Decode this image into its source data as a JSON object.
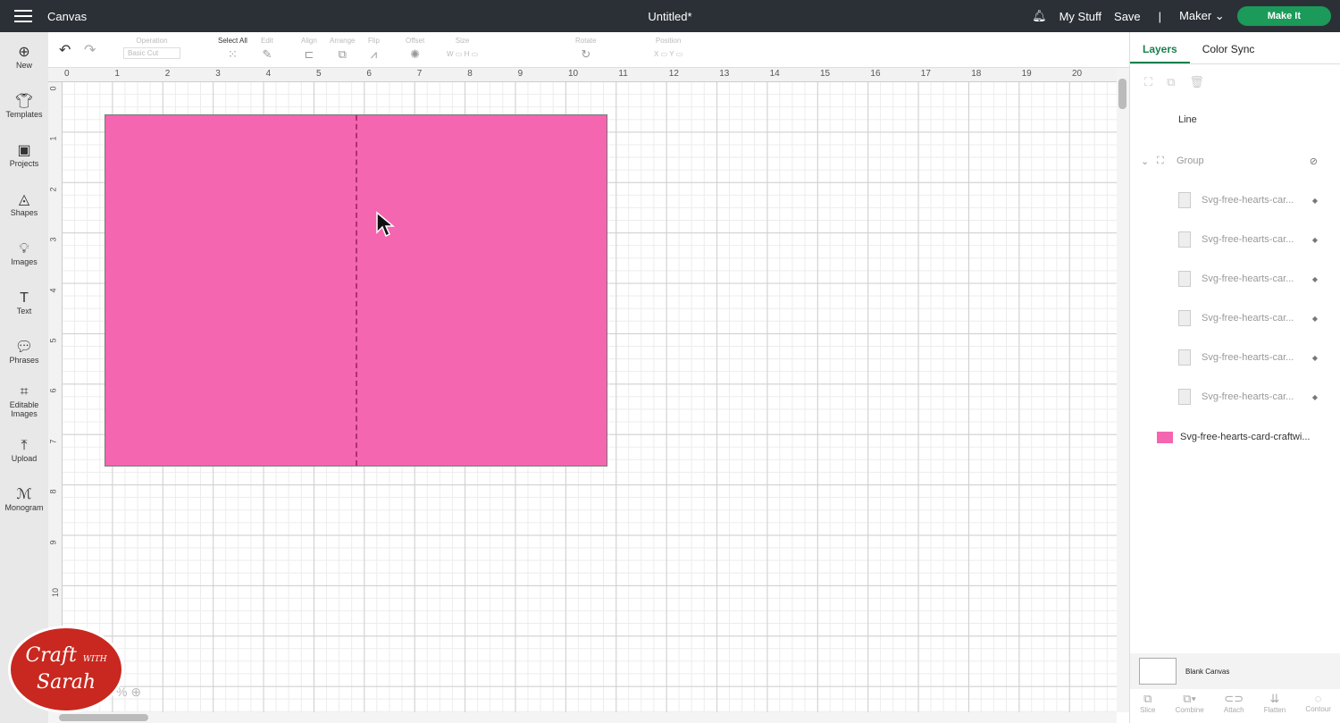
{
  "topbar": {
    "app": "Canvas",
    "doc_title": "Untitled*",
    "my_stuff": "My Stuff",
    "save": "Save",
    "separator": "|",
    "machine": "Maker",
    "make_it": "Make It"
  },
  "leftnav": [
    {
      "icon": "plus-circle-icon",
      "label": "New"
    },
    {
      "icon": "shirt-icon",
      "label": "Templates"
    },
    {
      "icon": "projects-icon",
      "label": "Projects"
    },
    {
      "icon": "shapes-icon",
      "label": "Shapes"
    },
    {
      "icon": "images-icon",
      "label": "Images"
    },
    {
      "icon": "text-icon",
      "label": "Text"
    },
    {
      "icon": "phrases-icon",
      "label": "Phrases"
    },
    {
      "icon": "editable-images-icon",
      "label": "Editable Images"
    },
    {
      "icon": "upload-icon",
      "label": "Upload"
    },
    {
      "icon": "monogram-icon",
      "label": "Monogram"
    }
  ],
  "toolbar": {
    "operation": "Operation",
    "operation_value": "Basic Cut",
    "select_all": "Select All",
    "edit": "Edit",
    "align": "Align",
    "arrange": "Arrange",
    "flip": "Flip",
    "offset": "Offset",
    "size": "Size",
    "w": "W",
    "h": "H",
    "rotate": "Rotate",
    "position": "Position",
    "x": "X",
    "y": "Y"
  },
  "ruler_h": [
    "0",
    "1",
    "2",
    "3",
    "4",
    "5",
    "6",
    "7",
    "8",
    "9",
    "10",
    "11",
    "12",
    "13",
    "14",
    "15",
    "16",
    "17",
    "18",
    "19",
    "20"
  ],
  "ruler_v": [
    "0",
    "1",
    "2",
    "3",
    "4",
    "5",
    "6",
    "7",
    "8",
    "9",
    "10"
  ],
  "canvas": {
    "card_color": "#f466b0"
  },
  "panel": {
    "tabs": [
      "Layers",
      "Color Sync"
    ],
    "layers": [
      {
        "name": "Line",
        "indent": 0
      },
      {
        "name": "Group",
        "indent": 0
      },
      {
        "name": "Svg-free-hearts-car...",
        "indent": 1
      },
      {
        "name": "Svg-free-hearts-car...",
        "indent": 1
      },
      {
        "name": "Svg-free-hearts-car...",
        "indent": 1
      },
      {
        "name": "Svg-free-hearts-car...",
        "indent": 1
      },
      {
        "name": "Svg-free-hearts-car...",
        "indent": 1
      },
      {
        "name": "Svg-free-hearts-car...",
        "indent": 1
      },
      {
        "name": "Svg-free-hearts-card-craftwi...",
        "indent": 0
      }
    ],
    "blank_canvas": "Blank Canvas",
    "bottom_tools": [
      "Slice",
      "Combine",
      "Attach",
      "Flatten",
      "Contour"
    ]
  },
  "zoom_text": "%",
  "watermark": "Craft with Sarah"
}
